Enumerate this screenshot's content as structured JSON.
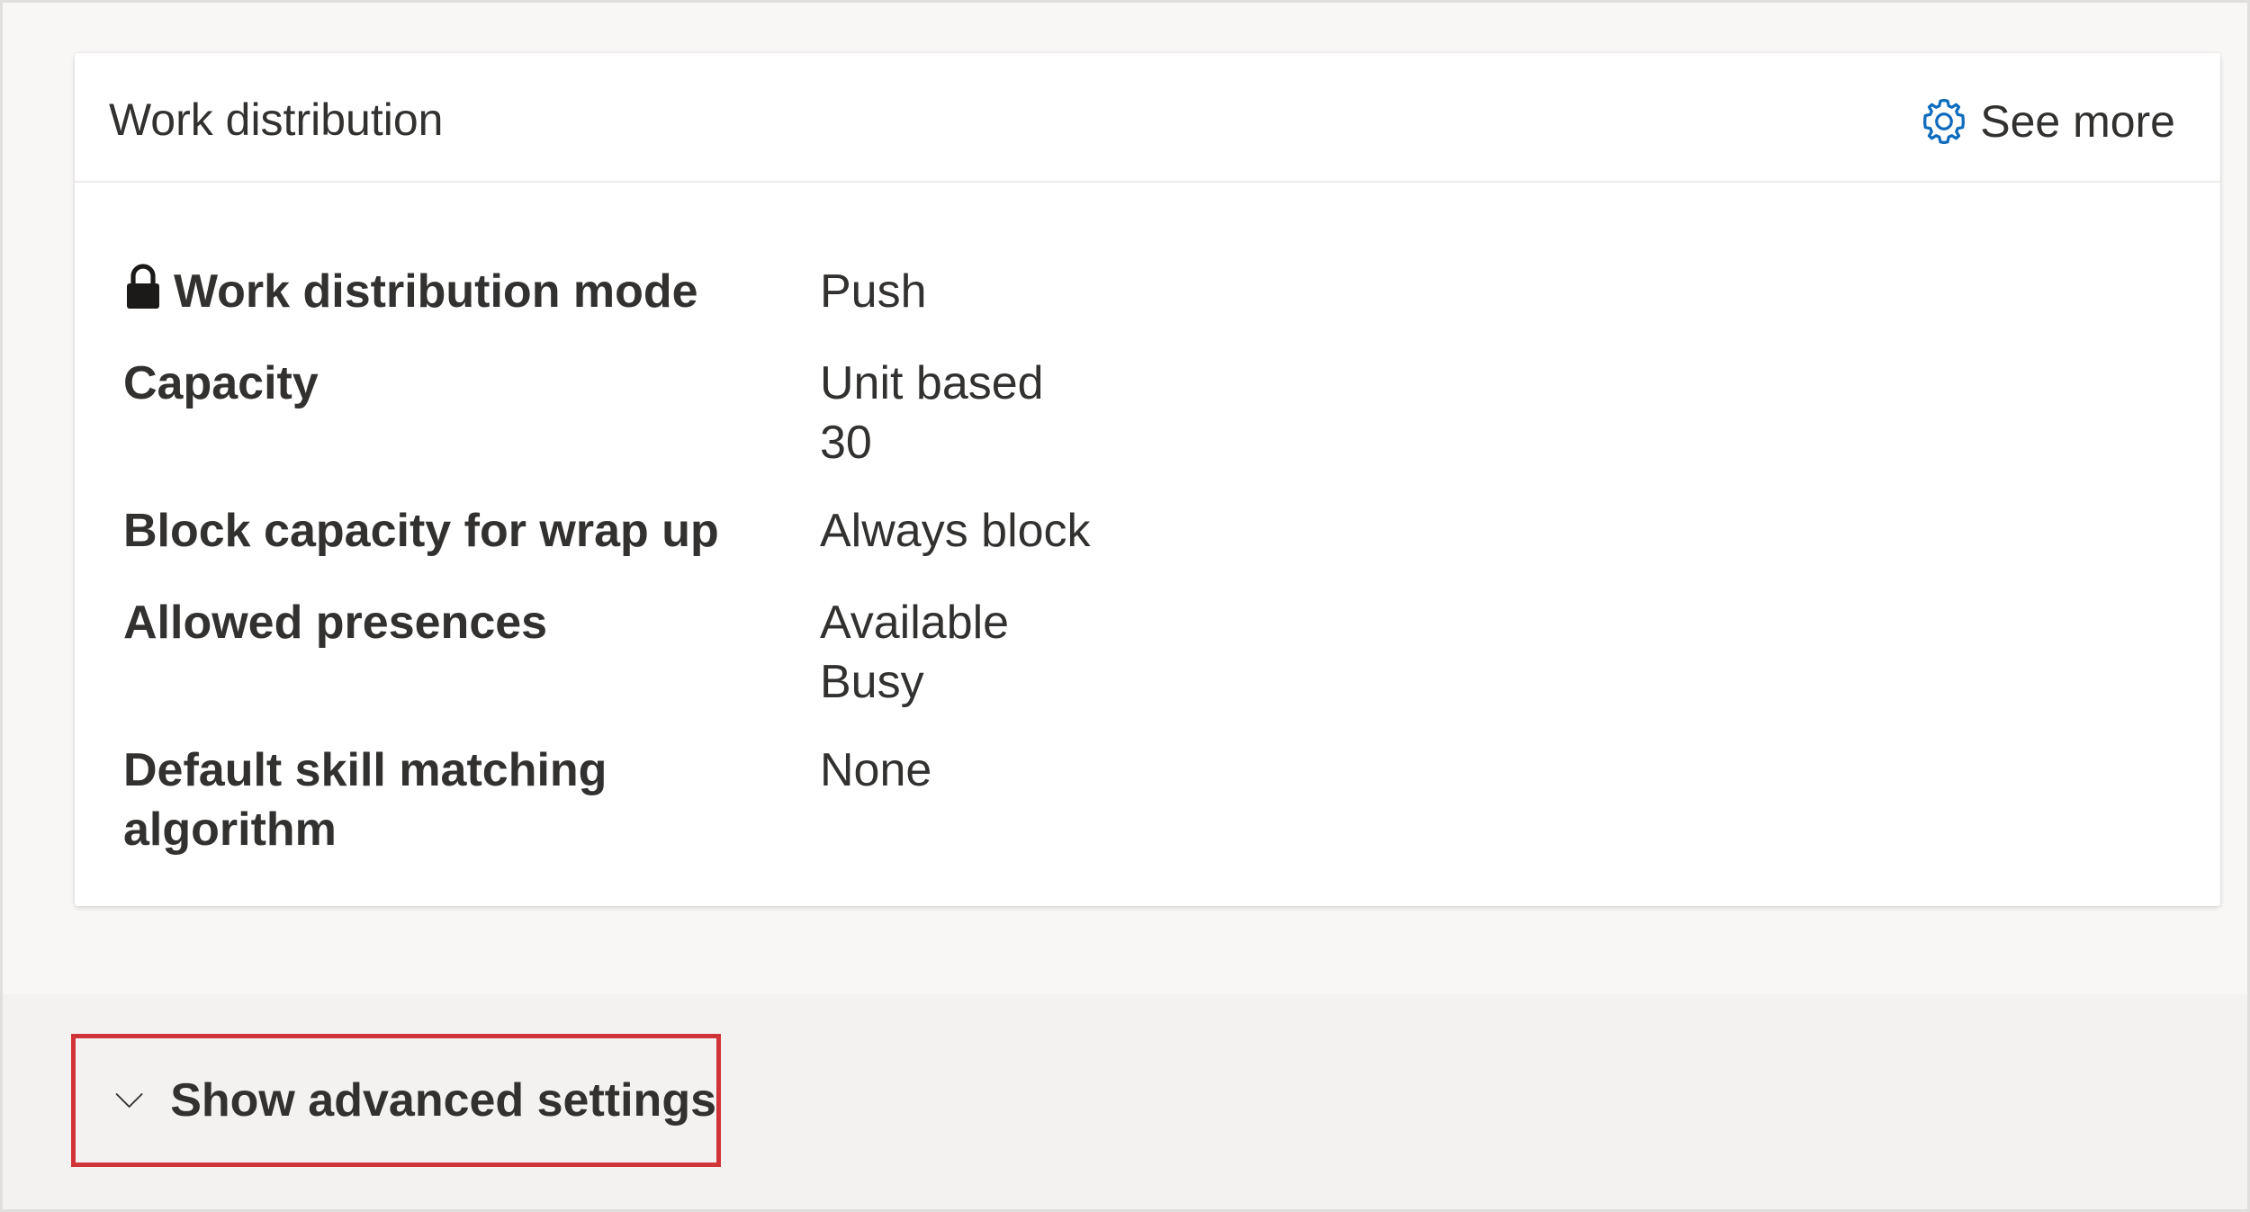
{
  "card": {
    "title": "Work distribution",
    "see_more_label": "See more"
  },
  "rows": [
    {
      "label": "Work distribution mode",
      "values": [
        "Push"
      ],
      "locked": true
    },
    {
      "label": "Capacity",
      "values": [
        "Unit based",
        "30"
      ]
    },
    {
      "label": "Block capacity for wrap up",
      "values": [
        "Always block"
      ]
    },
    {
      "label": "Allowed presences",
      "values": [
        "Available",
        "Busy"
      ]
    },
    {
      "label": "Default skill matching algorithm",
      "values": [
        "None"
      ]
    }
  ],
  "footer": {
    "advanced_label": "Show advanced settings"
  },
  "icons": {
    "see_more": "gear-icon",
    "lock": "lock-icon",
    "expand": "chevron-down-icon"
  },
  "colors": {
    "highlight_border": "#d13438",
    "gear": "#0f6cbd"
  }
}
